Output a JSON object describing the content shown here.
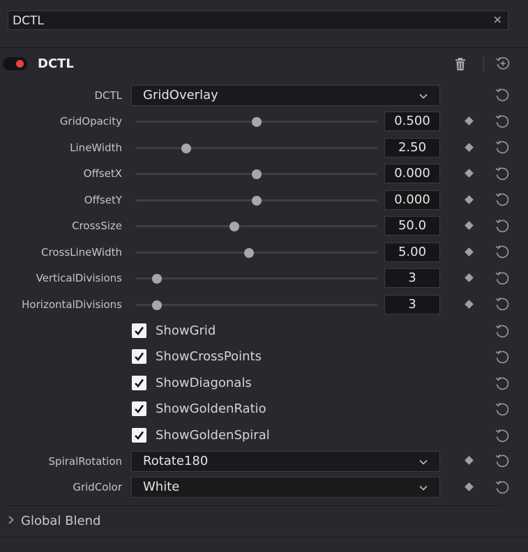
{
  "search": {
    "value": "DCTL",
    "clear_icon": "close-icon"
  },
  "header": {
    "title": "DCTL",
    "enabled": true,
    "toggle_color": "#e8433b"
  },
  "dctl_select": {
    "label": "DCTL",
    "value": "GridOverlay"
  },
  "sliders": [
    {
      "label": "GridOpacity",
      "value": "0.500",
      "position": 0.5
    },
    {
      "label": "LineWidth",
      "value": "2.50",
      "position": 0.21
    },
    {
      "label": "OffsetX",
      "value": "0.000",
      "position": 0.5
    },
    {
      "label": "OffsetY",
      "value": "0.000",
      "position": 0.5
    },
    {
      "label": "CrossSize",
      "value": "50.0",
      "position": 0.41
    },
    {
      "label": "CrossLineWidth",
      "value": "5.00",
      "position": 0.47
    },
    {
      "label": "VerticalDivisions",
      "value": "3",
      "position": 0.09
    },
    {
      "label": "HorizontalDivisions",
      "value": "3",
      "position": 0.09
    }
  ],
  "checkboxes": [
    {
      "label": "ShowGrid",
      "checked": true
    },
    {
      "label": "ShowCrossPoints",
      "checked": true
    },
    {
      "label": "ShowDiagonals",
      "checked": true
    },
    {
      "label": "ShowGoldenRatio",
      "checked": true
    },
    {
      "label": "ShowGoldenSpiral",
      "checked": true
    }
  ],
  "spiral_rotation": {
    "label": "SpiralRotation",
    "value": "Rotate180"
  },
  "grid_color": {
    "label": "GridColor",
    "value": "White"
  },
  "global_blend": {
    "label": "Global Blend"
  }
}
